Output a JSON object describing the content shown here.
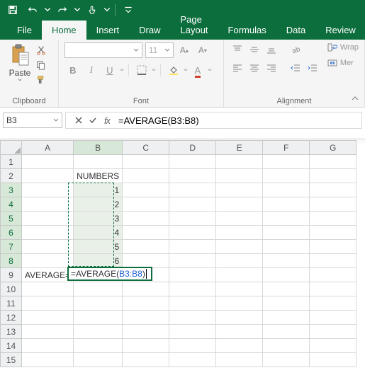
{
  "titlebar": {
    "save": "save",
    "undo": "undo",
    "redo": "redo",
    "touch": "touch-mode"
  },
  "tabs": [
    "File",
    "Home",
    "Insert",
    "Draw",
    "Page Layout",
    "Formulas",
    "Data",
    "Review"
  ],
  "active_tab": 1,
  "ribbon": {
    "clipboard": {
      "label": "Clipboard",
      "paste": "Paste"
    },
    "font": {
      "label": "Font",
      "name_placeholder": "",
      "size_placeholder": "11",
      "bold": "B",
      "italic": "I",
      "underline": "U"
    },
    "alignment": {
      "label": "Alignment",
      "wrap": "Wrap",
      "merge": "Mer"
    }
  },
  "formula_bar": {
    "name_box": "B3",
    "formula_display": "=AVERAGE(B3:B8)",
    "fx": "fx"
  },
  "grid": {
    "columns": [
      "A",
      "B",
      "C",
      "D",
      "E",
      "F",
      "G"
    ],
    "rows": 15,
    "cells": {
      "B2": "NUMBERS",
      "B3": "1",
      "B4": "2",
      "B5": "3",
      "B6": "4",
      "B7": "5",
      "B8": "6",
      "A9": "AVERAGE="
    },
    "editing": {
      "address": "B9",
      "prefix": "=AVERAGE(",
      "ref": "B3:B8",
      "suffix": ")"
    },
    "selected_range": "B3:B8"
  },
  "chart_data": {
    "type": "table",
    "title": "NUMBERS",
    "values": [
      1,
      2,
      3,
      4,
      5,
      6
    ],
    "label": "AVERAGE=",
    "formula": "=AVERAGE(B3:B8)"
  }
}
